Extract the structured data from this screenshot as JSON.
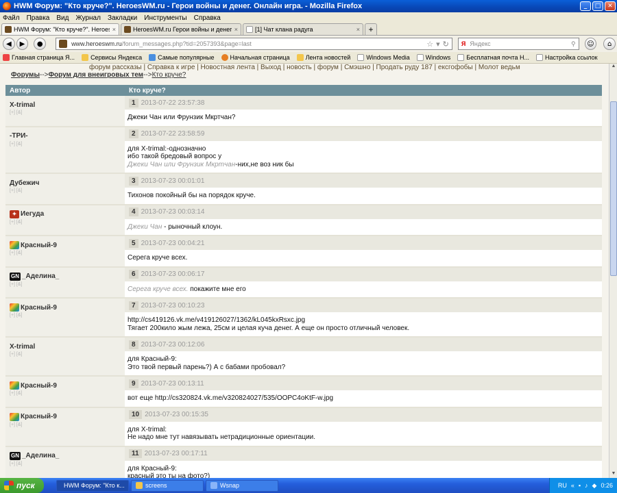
{
  "window": {
    "title": "HWM Форум: \"Кто круче?\". HeroesWM.ru - Герои войны и денег. Онлайн игра. - Mozilla Firefox"
  },
  "menu": [
    "Файл",
    "Правка",
    "Вид",
    "Журнал",
    "Закладки",
    "Инструменты",
    "Справка"
  ],
  "tabs": [
    {
      "label": "HWM Форум: \"Кто круче?\". HeroesWM....",
      "color": "#6b4a1f"
    },
    {
      "label": "HeroesWM.ru Герои войны и денег. Он...",
      "color": "#6b4a1f"
    },
    {
      "label": "[1] Чат клана радуга",
      "color": "#ffffff"
    }
  ],
  "nav": {
    "url_host": "www.heroeswm.ru",
    "url_path": "/forum_messages.php?tid=2057393&page=last",
    "search_placeholder": "Яндекс",
    "search_brand": "Я"
  },
  "bookmarks": [
    {
      "label": "Главная страница Я...",
      "color": "#e44"
    },
    {
      "label": "Сервисы Яндекса",
      "color": "#f3c64b"
    },
    {
      "label": "Самые популярные",
      "color": "#4a8fe0"
    },
    {
      "label": "Начальная страница",
      "color": "#e67e22"
    },
    {
      "label": "Лента новостей",
      "color": "#f3c64b"
    },
    {
      "label": "Windows Media",
      "color": "#ffffff"
    },
    {
      "label": "Windows",
      "color": "#ffffff"
    },
    {
      "label": "Бесплатная почта Н...",
      "color": "#ffffff"
    },
    {
      "label": "Настройка ссылок",
      "color": "#ffffff"
    }
  ],
  "page": {
    "toplinks": "форум рассказы | Справка к игре | Новостная лента | Выход | новость | форум | Смэшно | Продать руду 187 | ексгофобы | Молот ведьм",
    "crumb_forums": "Форумы",
    "crumb_sep1": "-->",
    "crumb_section": "Форум для внеигровых тем",
    "crumb_sep2": "-->",
    "crumb_topic": "Кто круче?",
    "col_author": "Автор",
    "col_topic": "Кто круче?"
  },
  "posts": [
    {
      "author": "X-trimal",
      "badge": "",
      "links": "[+] [&]",
      "num": "1",
      "date": "2013-07-22 23:57:38",
      "lines": [
        "Джеки Чан или Фрунзик Мкртчан?"
      ]
    },
    {
      "author": "-ТРИ-",
      "badge": "",
      "links": "[+] [&]",
      "num": "2",
      "date": "2013-07-22 23:58:59",
      "lines": [
        "для X-trimal:-однозначно",
        "ибо такой бредовый вопрос у",
        ""
      ],
      "quote": "Джеки Чан или Фрунзик Мкртчан",
      "after": "-них,не воз ник бы"
    },
    {
      "author": "Дубежич",
      "badge": "",
      "links": "[+] [&]",
      "num": "3",
      "date": "2013-07-23 00:01:01",
      "lines": [
        "Тихонов покойный бы на порядок круче."
      ]
    },
    {
      "author": "Иегуда",
      "badge": "shield",
      "links": "[+] [&]",
      "num": "4",
      "date": "2013-07-23 00:03:14",
      "lines": [],
      "quote": "Джеки Чан",
      "after": " - рыночный клоун."
    },
    {
      "author": "Красный-9",
      "badge": "rainbow",
      "links": "[+] [&]",
      "num": "5",
      "date": "2013-07-23 00:04:21",
      "lines": [
        "Серега круче всех."
      ]
    },
    {
      "author": "_Аделина_",
      "badge": "GN",
      "links": "[+] [&]",
      "num": "6",
      "date": "2013-07-23 00:06:17",
      "lines": [],
      "quote": "Серега круче всех.",
      "after": " покажите мне его"
    },
    {
      "author": "Красный-9",
      "badge": "rainbow",
      "links": "[+] [&]",
      "num": "7",
      "date": "2013-07-23 00:10:23",
      "lines": [
        "http://cs419126.vk.me/v419126027/1362/kL045kxRsxc.jpg",
        "Тягает 200кило жым лежа, 25см и целая куча денег. А еще он просто отличный человек."
      ]
    },
    {
      "author": "X-trimal",
      "badge": "",
      "links": "[+] [&]",
      "num": "8",
      "date": "2013-07-23 00:12:06",
      "lines": [
        "для Красный-9:",
        "Это твой первый парень?) А с бабами пробовал?"
      ]
    },
    {
      "author": "Красный-9",
      "badge": "rainbow",
      "links": "[+] [&]",
      "num": "9",
      "date": "2013-07-23 00:13:11",
      "lines": [
        "вот еще http://cs320824.vk.me/v320824027/535/OOPC4oKtF-w.jpg"
      ]
    },
    {
      "author": "Красный-9",
      "badge": "rainbow",
      "links": "[+] [&]",
      "num": "10",
      "date": "2013-07-23 00:15:35",
      "lines": [
        "для X-trimal:",
        "Не надо мне тут навязывать нетрадиционные ориентации."
      ]
    },
    {
      "author": "_Аделина_",
      "badge": "GN",
      "links": "[+] [&]",
      "num": "11",
      "date": "2013-07-23 00:17:11",
      "lines": [
        "для Красный-9:",
        "красный это ты на фото?)"
      ]
    }
  ],
  "taskbar": {
    "start": "пуск",
    "items": [
      {
        "label": "HWM Форум: \"Кто к...",
        "color": "#e67e22",
        "active": true
      },
      {
        "label": "screens",
        "color": "#f3c64b",
        "active": false
      },
      {
        "label": "Wsnap",
        "color": "#8ab4f8",
        "active": false
      }
    ],
    "lang": "RU",
    "clock": "0:26"
  }
}
